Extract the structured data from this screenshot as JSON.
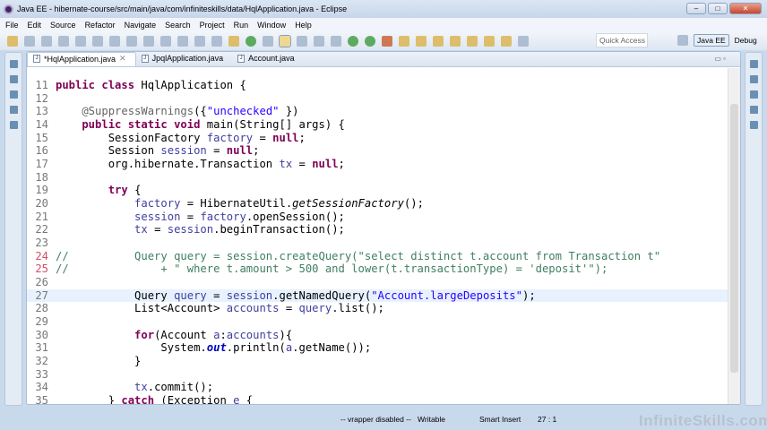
{
  "window": {
    "title": "Java EE - hibernate-course/src/main/java/com/infiniteskills/data/HqlApplication.java - Eclipse"
  },
  "menu": [
    "File",
    "Edit",
    "Source",
    "Refactor",
    "Navigate",
    "Search",
    "Project",
    "Run",
    "Window",
    "Help"
  ],
  "toolbar": {
    "quick_access": "Quick Access",
    "perspectives": [
      "Java EE",
      "Debug"
    ]
  },
  "tabs": [
    {
      "label": "*HqlApplication.java",
      "active": true
    },
    {
      "label": "JpqlApplication.java"
    },
    {
      "label": "Account.java"
    }
  ],
  "code": [
    {
      "n": "11",
      "seg": [
        [
          "k",
          "public class "
        ],
        [
          "",
          "HqlApplication {"
        ]
      ]
    },
    {
      "n": "12",
      "seg": []
    },
    {
      "n": "13",
      "seg": [
        [
          "a",
          "    @SuppressWarnings"
        ],
        [
          "",
          "({"
        ],
        [
          "s",
          "\"unchecked\""
        ],
        [
          "",
          " })"
        ]
      ]
    },
    {
      "n": "14",
      "seg": [
        [
          "k",
          "    public static void "
        ],
        [
          "",
          "main(String[] args) {"
        ]
      ]
    },
    {
      "n": "15",
      "seg": [
        [
          "",
          "        SessionFactory "
        ],
        [
          "v",
          "factory"
        ],
        [
          "",
          " = "
        ],
        [
          "k",
          "null"
        ],
        [
          "",
          ";"
        ]
      ]
    },
    {
      "n": "16",
      "seg": [
        [
          "",
          "        Session "
        ],
        [
          "v",
          "session"
        ],
        [
          "",
          " = "
        ],
        [
          "k",
          "null"
        ],
        [
          "",
          ";"
        ]
      ]
    },
    {
      "n": "17",
      "seg": [
        [
          "",
          "        org.hibernate.Transaction "
        ],
        [
          "v",
          "tx"
        ],
        [
          "",
          " = "
        ],
        [
          "k",
          "null"
        ],
        [
          "",
          ";"
        ]
      ]
    },
    {
      "n": "18",
      "seg": []
    },
    {
      "n": "19",
      "seg": [
        [
          "k",
          "        try "
        ],
        [
          "",
          "{"
        ]
      ]
    },
    {
      "n": "20",
      "seg": [
        [
          "v",
          "            factory"
        ],
        [
          "",
          " = HibernateUtil."
        ],
        [
          "i",
          "getSessionFactory"
        ],
        [
          "",
          "();"
        ]
      ]
    },
    {
      "n": "21",
      "seg": [
        [
          "v",
          "            session"
        ],
        [
          "",
          " = "
        ],
        [
          "v",
          "factory"
        ],
        [
          "",
          ".openSession();"
        ]
      ]
    },
    {
      "n": "22",
      "seg": [
        [
          "v",
          "            tx"
        ],
        [
          "",
          " = "
        ],
        [
          "v",
          "session"
        ],
        [
          "",
          ".beginTransaction();"
        ]
      ]
    },
    {
      "n": "23",
      "seg": []
    },
    {
      "n": "24",
      "mark": true,
      "seg": [
        [
          "c",
          "//          Query query = session.createQuery(\"select distinct t.account from Transaction t\""
        ]
      ]
    },
    {
      "n": "25",
      "mark": true,
      "seg": [
        [
          "c",
          "//              + \" where t.amount > 500 and lower(t.transactionType) = 'deposit'\");"
        ]
      ]
    },
    {
      "n": "26",
      "seg": []
    },
    {
      "n": "27",
      "cur": true,
      "seg": [
        [
          "",
          "            Query "
        ],
        [
          "v",
          "query"
        ],
        [
          "",
          " = "
        ],
        [
          "v",
          "session"
        ],
        [
          "",
          ".getNamedQuery("
        ],
        [
          "s",
          "\"Account.largeDeposits\""
        ],
        [
          "",
          ");"
        ]
      ]
    },
    {
      "n": "28",
      "seg": [
        [
          "",
          "            List<Account> "
        ],
        [
          "v",
          "accounts"
        ],
        [
          "",
          " = "
        ],
        [
          "v",
          "query"
        ],
        [
          "",
          ".list();"
        ]
      ]
    },
    {
      "n": "29",
      "seg": []
    },
    {
      "n": "30",
      "seg": [
        [
          "k",
          "            for"
        ],
        [
          "",
          "(Account "
        ],
        [
          "v",
          "a"
        ],
        [
          "",
          ":"
        ],
        [
          "v",
          "accounts"
        ],
        [
          "",
          "){"
        ]
      ]
    },
    {
      "n": "31",
      "seg": [
        [
          "",
          "                System."
        ],
        [
          "f",
          "out"
        ],
        [
          "",
          ".println("
        ],
        [
          "v",
          "a"
        ],
        [
          "",
          ".getName());"
        ]
      ]
    },
    {
      "n": "32",
      "seg": [
        [
          "",
          "            }"
        ]
      ]
    },
    {
      "n": "33",
      "seg": []
    },
    {
      "n": "34",
      "seg": [
        [
          "v",
          "            tx"
        ],
        [
          "",
          ".commit();"
        ]
      ]
    },
    {
      "n": "35",
      "seg": [
        [
          "",
          "        } "
        ],
        [
          "k",
          "catch "
        ],
        [
          "",
          "(Exception "
        ],
        [
          "v",
          "e"
        ],
        [
          "",
          " {"
        ]
      ]
    }
  ],
  "status": {
    "vrapper": "-- vrapper disabled --",
    "writable": "Writable",
    "insert": "Smart Insert",
    "position": "27 : 1"
  },
  "watermark": "InfiniteSkills.com"
}
